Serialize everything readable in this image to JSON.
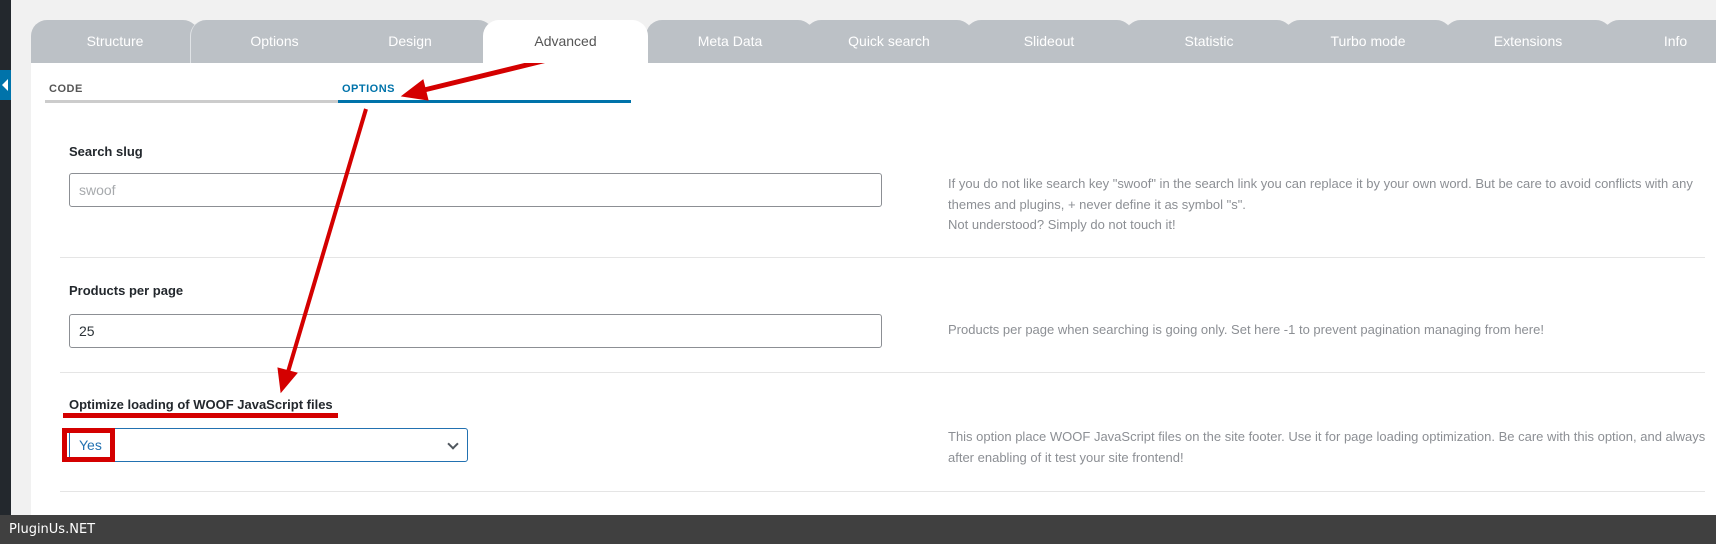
{
  "tabs": [
    {
      "label": "Structure"
    },
    {
      "label": "Options"
    },
    {
      "label": "Design"
    },
    {
      "label": "Advanced"
    },
    {
      "label": "Meta Data"
    },
    {
      "label": "Quick search"
    },
    {
      "label": "Slideout"
    },
    {
      "label": "Statistic"
    },
    {
      "label": "Turbo mode"
    },
    {
      "label": "Extensions"
    },
    {
      "label": "Info"
    }
  ],
  "active_tab": "Advanced",
  "subtabs": [
    {
      "label": "CODE"
    },
    {
      "label": "OPTIONS"
    }
  ],
  "fields": {
    "search_slug": {
      "label": "Search slug",
      "placeholder": "swoof",
      "help": [
        "If you do not like search key \"swoof\" in the search link you can replace it by your own word. But be care to avoid conflicts with any themes and plugins, + never define it as symbol \"s\".",
        "Not understood? Simply do not touch it!"
      ]
    },
    "products_per_page": {
      "label": "Products per page",
      "value": "25",
      "help": "Products per page when searching is going only. Set here -1 to prevent pagination managing from here!"
    },
    "optimize_js": {
      "label": "Optimize loading of WOOF JavaScript files",
      "value": "Yes",
      "help": "This option place WOOF JavaScript files on the site footer. Use it for page loading optimization. Be care with this option, and always after enabling of it test your site frontend!"
    }
  },
  "footer": {
    "watermark": "PluginUs.NET"
  },
  "colors": {
    "accent": "#0073aa",
    "annotation": "#d40000",
    "tab": "#bcc1c6"
  }
}
